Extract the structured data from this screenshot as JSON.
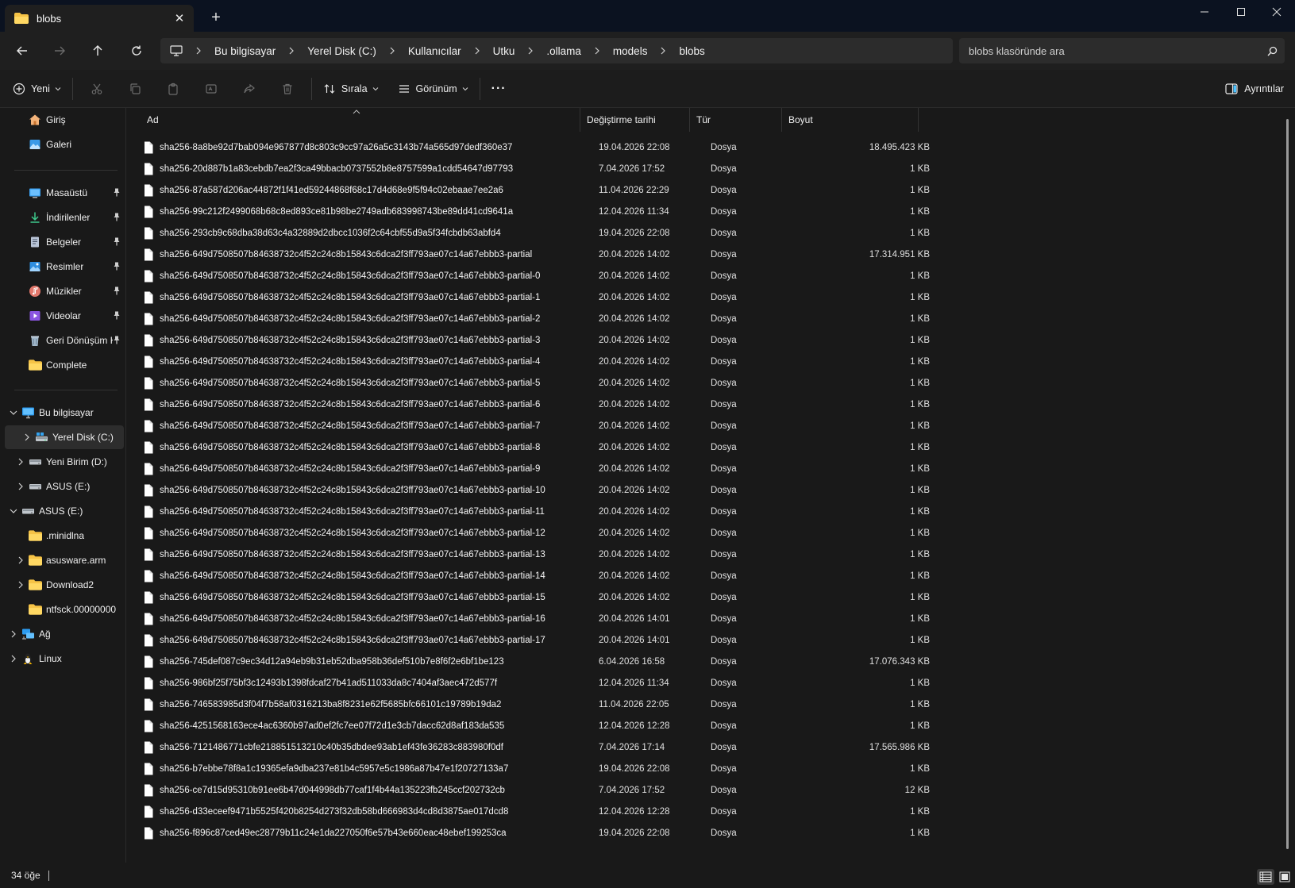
{
  "window": {
    "tab_title": "blobs",
    "tab_close": "✕",
    "tab_add": "+"
  },
  "colors": {
    "accent": "#4cc2ff",
    "folder": "#f6c346",
    "background": "#191919"
  },
  "address": {
    "crumbs": [
      "Bu bilgisayar",
      "Yerel Disk (C:)",
      "Kullanıcılar",
      "Utku",
      ".ollama",
      "models",
      "blobs"
    ]
  },
  "search": {
    "placeholder": "blobs klasöründe ara"
  },
  "commands": {
    "new": "Yeni",
    "sort": "Sırala",
    "view": "Görünüm",
    "more": "···",
    "details": "Ayrıntılar"
  },
  "sidebar": {
    "quick": [
      {
        "label": "Giriş",
        "icon": "home-icon"
      },
      {
        "label": "Galeri",
        "icon": "gallery-icon"
      }
    ],
    "pinned": [
      {
        "label": "Masaüstü",
        "icon": "desktop-icon"
      },
      {
        "label": "İndirilenler",
        "icon": "download-icon"
      },
      {
        "label": "Belgeler",
        "icon": "documents-icon"
      },
      {
        "label": "Resimler",
        "icon": "pictures-icon"
      },
      {
        "label": "Müzikler",
        "icon": "music-icon"
      },
      {
        "label": "Videolar",
        "icon": "videos-icon"
      },
      {
        "label": "Geri Dönüşüm Kutusu",
        "icon": "recycle-bin-icon"
      },
      {
        "label": "Complete",
        "icon": "folder-icon"
      }
    ],
    "tree": [
      {
        "label": "Bu bilgisayar",
        "icon": "computer-icon",
        "chev": "down",
        "indent": 0
      },
      {
        "label": "Yerel Disk (C:)",
        "icon": "drive-c-icon",
        "chev": "right",
        "indent": 1,
        "selected": true
      },
      {
        "label": "Yeni Birim (D:)",
        "icon": "drive-icon",
        "chev": "right",
        "indent": 1
      },
      {
        "label": "ASUS (E:)",
        "icon": "drive-icon",
        "chev": "right",
        "indent": 1
      },
      {
        "label": "ASUS (E:)",
        "icon": "drive-icon",
        "chev": "down",
        "indent": 0
      },
      {
        "label": ".minidlna",
        "icon": "folder-icon",
        "chev": "",
        "indent": 1
      },
      {
        "label": "asusware.arm",
        "icon": "folder-icon",
        "chev": "right",
        "indent": 1
      },
      {
        "label": "Download2",
        "icon": "folder-icon",
        "chev": "right",
        "indent": 1
      },
      {
        "label": "ntfsck.00000000",
        "icon": "folder-icon",
        "chev": "",
        "indent": 1
      },
      {
        "label": "Ağ",
        "icon": "network-icon",
        "chev": "right",
        "indent": 0
      },
      {
        "label": "Linux",
        "icon": "linux-icon",
        "chev": "right",
        "indent": 0
      }
    ]
  },
  "columns": [
    "Ad",
    "Değiştirme tarihi",
    "Tür",
    "Boyut"
  ],
  "files": [
    [
      "sha256-8a8be92d7bab094e967877d8c803c9cc97a26a5c3143b74a565d97dedf360e37",
      "19.04.2026 22:08",
      "Dosya",
      "18.495.423 KB"
    ],
    [
      "sha256-20d887b1a83cebdb7ea2f3ca49bbacb0737552b8e8757599a1cdd54647d97793",
      "7.04.2026 17:52",
      "Dosya",
      "1 KB"
    ],
    [
      "sha256-87a587d206ac44872f1f41ed59244868f68c17d4d68e9f5f94c02ebaae7ee2a6",
      "11.04.2026 22:29",
      "Dosya",
      "1 KB"
    ],
    [
      "sha256-99c212f2499068b68c8ed893ce81b98be2749adb683998743be89dd41cd9641a",
      "12.04.2026 11:34",
      "Dosya",
      "1 KB"
    ],
    [
      "sha256-293cb9c68dba38d63c4a32889d2dbcc1036f2c64cbf55d9a5f34fcbdb63abfd4",
      "19.04.2026 22:08",
      "Dosya",
      "1 KB"
    ],
    [
      "sha256-649d7508507b84638732c4f52c24c8b15843c6dca2f3ff793ae07c14a67ebbb3-partial",
      "20.04.2026 14:02",
      "Dosya",
      "17.314.951 KB"
    ],
    [
      "sha256-649d7508507b84638732c4f52c24c8b15843c6dca2f3ff793ae07c14a67ebbb3-partial-0",
      "20.04.2026 14:02",
      "Dosya",
      "1 KB"
    ],
    [
      "sha256-649d7508507b84638732c4f52c24c8b15843c6dca2f3ff793ae07c14a67ebbb3-partial-1",
      "20.04.2026 14:02",
      "Dosya",
      "1 KB"
    ],
    [
      "sha256-649d7508507b84638732c4f52c24c8b15843c6dca2f3ff793ae07c14a67ebbb3-partial-2",
      "20.04.2026 14:02",
      "Dosya",
      "1 KB"
    ],
    [
      "sha256-649d7508507b84638732c4f52c24c8b15843c6dca2f3ff793ae07c14a67ebbb3-partial-3",
      "20.04.2026 14:02",
      "Dosya",
      "1 KB"
    ],
    [
      "sha256-649d7508507b84638732c4f52c24c8b15843c6dca2f3ff793ae07c14a67ebbb3-partial-4",
      "20.04.2026 14:02",
      "Dosya",
      "1 KB"
    ],
    [
      "sha256-649d7508507b84638732c4f52c24c8b15843c6dca2f3ff793ae07c14a67ebbb3-partial-5",
      "20.04.2026 14:02",
      "Dosya",
      "1 KB"
    ],
    [
      "sha256-649d7508507b84638732c4f52c24c8b15843c6dca2f3ff793ae07c14a67ebbb3-partial-6",
      "20.04.2026 14:02",
      "Dosya",
      "1 KB"
    ],
    [
      "sha256-649d7508507b84638732c4f52c24c8b15843c6dca2f3ff793ae07c14a67ebbb3-partial-7",
      "20.04.2026 14:02",
      "Dosya",
      "1 KB"
    ],
    [
      "sha256-649d7508507b84638732c4f52c24c8b15843c6dca2f3ff793ae07c14a67ebbb3-partial-8",
      "20.04.2026 14:02",
      "Dosya",
      "1 KB"
    ],
    [
      "sha256-649d7508507b84638732c4f52c24c8b15843c6dca2f3ff793ae07c14a67ebbb3-partial-9",
      "20.04.2026 14:02",
      "Dosya",
      "1 KB"
    ],
    [
      "sha256-649d7508507b84638732c4f52c24c8b15843c6dca2f3ff793ae07c14a67ebbb3-partial-10",
      "20.04.2026 14:02",
      "Dosya",
      "1 KB"
    ],
    [
      "sha256-649d7508507b84638732c4f52c24c8b15843c6dca2f3ff793ae07c14a67ebbb3-partial-11",
      "20.04.2026 14:02",
      "Dosya",
      "1 KB"
    ],
    [
      "sha256-649d7508507b84638732c4f52c24c8b15843c6dca2f3ff793ae07c14a67ebbb3-partial-12",
      "20.04.2026 14:02",
      "Dosya",
      "1 KB"
    ],
    [
      "sha256-649d7508507b84638732c4f52c24c8b15843c6dca2f3ff793ae07c14a67ebbb3-partial-13",
      "20.04.2026 14:02",
      "Dosya",
      "1 KB"
    ],
    [
      "sha256-649d7508507b84638732c4f52c24c8b15843c6dca2f3ff793ae07c14a67ebbb3-partial-14",
      "20.04.2026 14:02",
      "Dosya",
      "1 KB"
    ],
    [
      "sha256-649d7508507b84638732c4f52c24c8b15843c6dca2f3ff793ae07c14a67ebbb3-partial-15",
      "20.04.2026 14:02",
      "Dosya",
      "1 KB"
    ],
    [
      "sha256-649d7508507b84638732c4f52c24c8b15843c6dca2f3ff793ae07c14a67ebbb3-partial-16",
      "20.04.2026 14:01",
      "Dosya",
      "1 KB"
    ],
    [
      "sha256-649d7508507b84638732c4f52c24c8b15843c6dca2f3ff793ae07c14a67ebbb3-partial-17",
      "20.04.2026 14:01",
      "Dosya",
      "1 KB"
    ],
    [
      "sha256-745def087c9ec34d12a94eb9b31eb52dba958b36def510b7e8f6f2e6bf1be123",
      "6.04.2026 16:58",
      "Dosya",
      "17.076.343 KB"
    ],
    [
      "sha256-986bf25f75bf3c12493b1398fdcaf27b41ad511033da8c7404af3aec472d577f",
      "12.04.2026 11:34",
      "Dosya",
      "1 KB"
    ],
    [
      "sha256-746583985d3f04f7b58af0316213ba8f8231e62f5685bfc66101c19789b19da2",
      "11.04.2026 22:05",
      "Dosya",
      "1 KB"
    ],
    [
      "sha256-4251568163ece4ac6360b97ad0ef2fc7ee07f72d1e3cb7dacc62d8af183da535",
      "12.04.2026 12:28",
      "Dosya",
      "1 KB"
    ],
    [
      "sha256-7121486771cbfe218851513210c40b35dbdee93ab1ef43fe36283c883980f0df",
      "7.04.2026 17:14",
      "Dosya",
      "17.565.986 KB"
    ],
    [
      "sha256-b7ebbe78f8a1c19365efa9dba237e81b4c5957e5c1986a87b47e1f20727133a7",
      "19.04.2026 22:08",
      "Dosya",
      "1 KB"
    ],
    [
      "sha256-ce7d15d95310b91ee6b47d044998db77caf1f4b44a135223fb245ccf202732cb",
      "7.04.2026 17:52",
      "Dosya",
      "12 KB"
    ],
    [
      "sha256-d33eceef9471b5525f420b8254d273f32db58bd666983d4cd8d3875ae017dcd8",
      "12.04.2026 12:28",
      "Dosya",
      "1 KB"
    ],
    [
      "sha256-f896c87ced49ec28779b11c24e1da227050f6e57b43e660eac48ebef199253ca",
      "19.04.2026 22:08",
      "Dosya",
      "1 KB"
    ]
  ],
  "status": {
    "count": "34 öğe"
  }
}
